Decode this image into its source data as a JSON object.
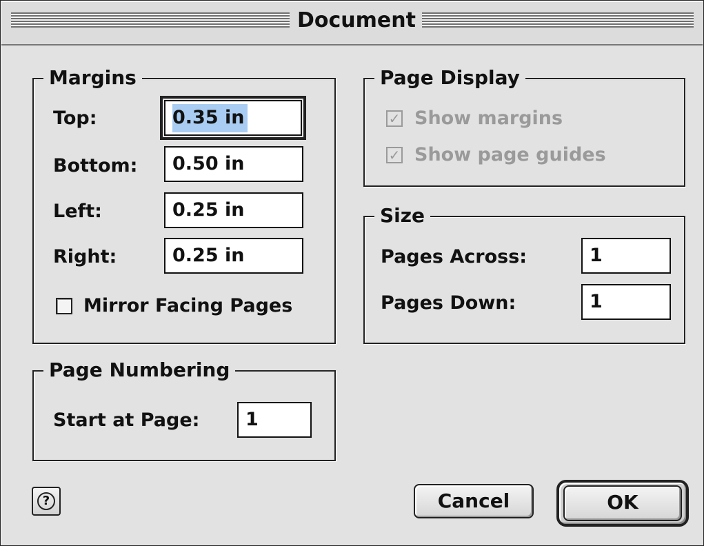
{
  "window": {
    "title": "Document"
  },
  "margins": {
    "legend": "Margins",
    "top_label": "Top:",
    "top_value": "0.35 in",
    "bottom_label": "Bottom:",
    "bottom_value": "0.50 in",
    "left_label": "Left:",
    "left_value": "0.25 in",
    "right_label": "Right:",
    "right_value": "0.25 in",
    "mirror_label": "Mirror Facing Pages",
    "mirror_checked": false
  },
  "page_display": {
    "legend": "Page Display",
    "show_margins_label": "Show margins",
    "show_margins_checked": true,
    "show_guides_label": "Show page guides",
    "show_guides_checked": true,
    "disabled": true
  },
  "size": {
    "legend": "Size",
    "across_label": "Pages Across:",
    "across_value": "1",
    "down_label": "Pages Down:",
    "down_value": "1"
  },
  "page_numbering": {
    "legend": "Page Numbering",
    "start_label": "Start at Page:",
    "start_value": "1"
  },
  "buttons": {
    "cancel": "Cancel",
    "ok": "OK",
    "help_icon": "question-mark-icon"
  },
  "colors": {
    "selection": "#a9cdf2",
    "disabled_text": "#9a9a9a",
    "dialog_bg": "#e2e2e2"
  }
}
